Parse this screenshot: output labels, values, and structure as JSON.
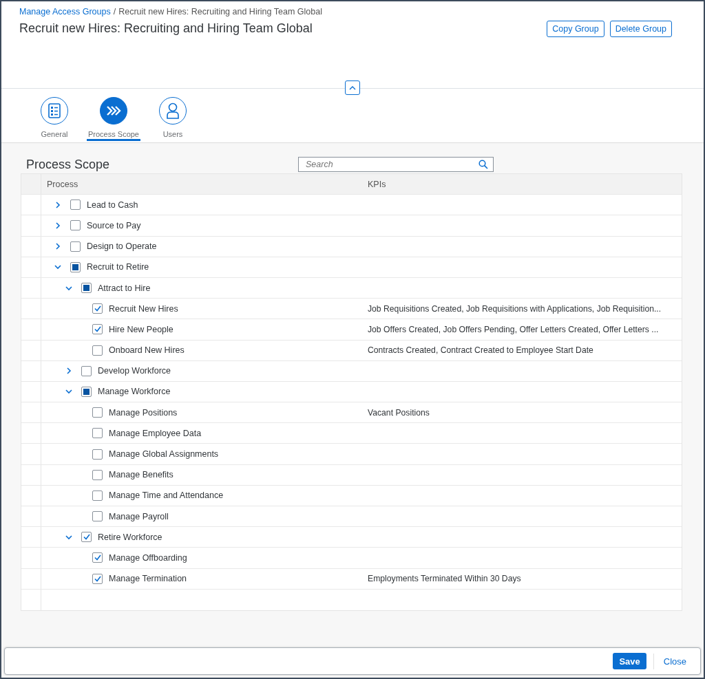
{
  "breadcrumb": {
    "link": "Manage Access Groups",
    "separator": "/",
    "current": "Recruit new Hires: Recruiting and Hiring Team Global"
  },
  "title": "Recruit new Hires: Recruiting and Hiring Team Global",
  "header_actions": [
    "Copy Group",
    "Delete Group"
  ],
  "tabs": [
    {
      "label": "General",
      "selected": false
    },
    {
      "label": "Process Scope",
      "selected": true
    },
    {
      "label": "Users",
      "selected": false
    }
  ],
  "section_title": "Process Scope",
  "search": {
    "placeholder": "Search"
  },
  "table": {
    "columns": [
      "Process",
      "KPIs"
    ],
    "rows": [
      {
        "name": "Lead to Cash",
        "expanded": false,
        "checked": false
      },
      {
        "name": "Source to Pay",
        "expanded": false,
        "checked": false
      },
      {
        "name": "Design to Operate",
        "expanded": false,
        "checked": false
      },
      {
        "name": "Recruit to Retire",
        "expanded": true,
        "partial": true,
        "children": [
          {
            "name": "Attract to Hire",
            "expanded": true,
            "partial": true,
            "children": [
              {
                "name": "Recruit New Hires",
                "checked": true,
                "kpis": "Job Requisitions Created, Job Requisitions with Applications, Job Requisition..."
              },
              {
                "name": "Hire New People",
                "checked": true,
                "kpis": "Job Offers Created, Job Offers Pending, Offer Letters Created, Offer Letters ..."
              },
              {
                "name": "Onboard New Hires",
                "checked": false,
                "kpis": "Contracts Created, Contract Created to Employee Start Date"
              }
            ]
          },
          {
            "name": "Develop Workforce",
            "expanded": false,
            "checked": false
          },
          {
            "name": "Manage Workforce",
            "expanded": true,
            "partial": true,
            "children": [
              {
                "name": "Manage Positions",
                "checked": false,
                "kpis": "Vacant Positions"
              },
              {
                "name": "Manage Employee Data",
                "checked": false
              },
              {
                "name": "Manage Global Assignments",
                "checked": false
              },
              {
                "name": "Manage Benefits",
                "checked": false
              },
              {
                "name": "Manage Time and Attendance",
                "checked": false
              },
              {
                "name": "Manage Payroll",
                "checked": false
              }
            ]
          },
          {
            "name": "Retire Workforce",
            "expanded": true,
            "checked": true,
            "children": [
              {
                "name": "Manage Offboarding",
                "checked": true
              },
              {
                "name": "Manage Termination",
                "checked": true,
                "kpis": "Employments Terminated Within 30 Days"
              }
            ]
          }
        ]
      }
    ]
  },
  "footer_actions": [
    {
      "label": "Save",
      "kind": "primary"
    },
    {
      "label": "Close",
      "kind": "plain"
    }
  ]
}
